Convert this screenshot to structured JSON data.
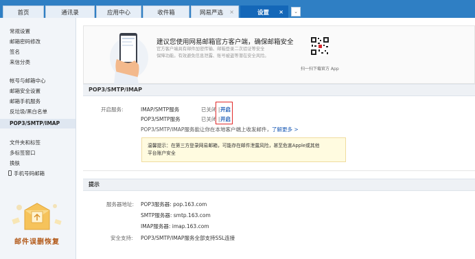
{
  "tabs": [
    {
      "label": "首页",
      "closable": false,
      "active": false
    },
    {
      "label": "通讯录",
      "closable": false,
      "active": false
    },
    {
      "label": "应用中心",
      "closable": false,
      "active": false
    },
    {
      "label": "收件箱",
      "closable": false,
      "active": false
    },
    {
      "label": "网易严选",
      "closable": true,
      "active": false
    },
    {
      "label": "设置",
      "closable": true,
      "active": true
    }
  ],
  "tab_close_glyph": "×",
  "tab_more_glyph": "⌄",
  "sidebar": {
    "items": [
      "常规设置",
      "邮箱密码修改",
      "签名",
      "来信分类",
      "帐号与邮箱中心",
      "邮箱安全设置",
      "邮箱手机服务",
      "反垃圾/黑白名单",
      "POP3/SMTP/IMAP",
      "文件夹和标签",
      "多标签窗口",
      "换肤",
      "手机号码邮箱"
    ],
    "promo_text": "邮件误删恢复"
  },
  "banner": {
    "title": "建议您使用网易邮箱官方客户端，确保邮箱安全",
    "desc_line1": "官方客户端具有邮件加密传输、邮箱登录二次验证等安全",
    "desc_line2": "保障功能。有效避免信息泄露、账号被盗等潜在安全风险。",
    "qr_caption": "扫一扫下载官方 App"
  },
  "pop_section": {
    "title": "POP3/SMTP/IMAP",
    "enable_label": "开启服务:",
    "services": [
      {
        "name": "IMAP/SMTP服务",
        "status": "已关闭 |",
        "action": "开启"
      },
      {
        "name": "POP3/SMTP服务",
        "status": "已关闭 |",
        "action": "开启"
      }
    ],
    "note": "POP3/SMTP/IMAP服务能让你在本地客户端上收发邮件，",
    "learn_more": "了解更多 >",
    "tip_line1": "温馨提示：在第三方登录网易邮箱，可能存在邮件泄露风险，甚至危害Apple或其他",
    "tip_line2": "平台账户安全"
  },
  "hint_section": {
    "title": "提示",
    "server_label": "服务器地址:",
    "servers": [
      "POP3服务器: pop.163.com",
      "SMTP服务器: smtp.163.com",
      "IMAP服务器: imap.163.com"
    ],
    "security_label": "安全支持:",
    "security_text": "POP3/SMTP/IMAP服务全部支持SSL连接"
  },
  "colors": {
    "accent": "#1467b8",
    "link": "#1a5ab5",
    "highlight_box": "#e02a2a"
  }
}
